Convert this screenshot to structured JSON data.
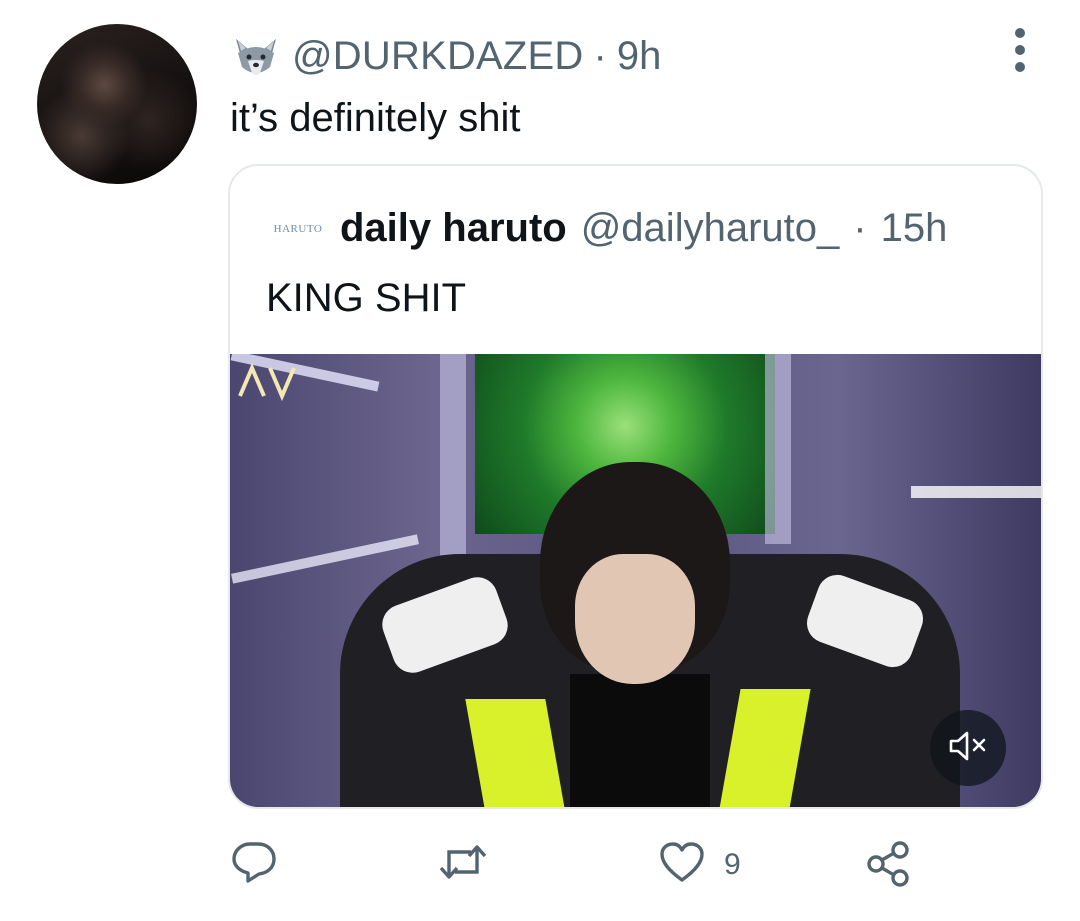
{
  "tweet": {
    "handle": "@DURKDAZED",
    "separator": "·",
    "time": "9h",
    "text": "it’s definitely shit",
    "emoji_icon": "wolf-face-icon"
  },
  "quote": {
    "avatar_text": "HARUTO",
    "display_name": "daily haruto",
    "handle": "@dailyharuto_",
    "separator": "·",
    "time": "15h",
    "text": "KING SHIT",
    "media": {
      "type": "video",
      "muted": true
    }
  },
  "actions": {
    "reply_count": "",
    "retweet_count": "",
    "like_count": "9",
    "share_count": ""
  },
  "colors": {
    "text_primary": "#0f1419",
    "text_secondary": "#536471",
    "border": "#e6e9ec"
  }
}
